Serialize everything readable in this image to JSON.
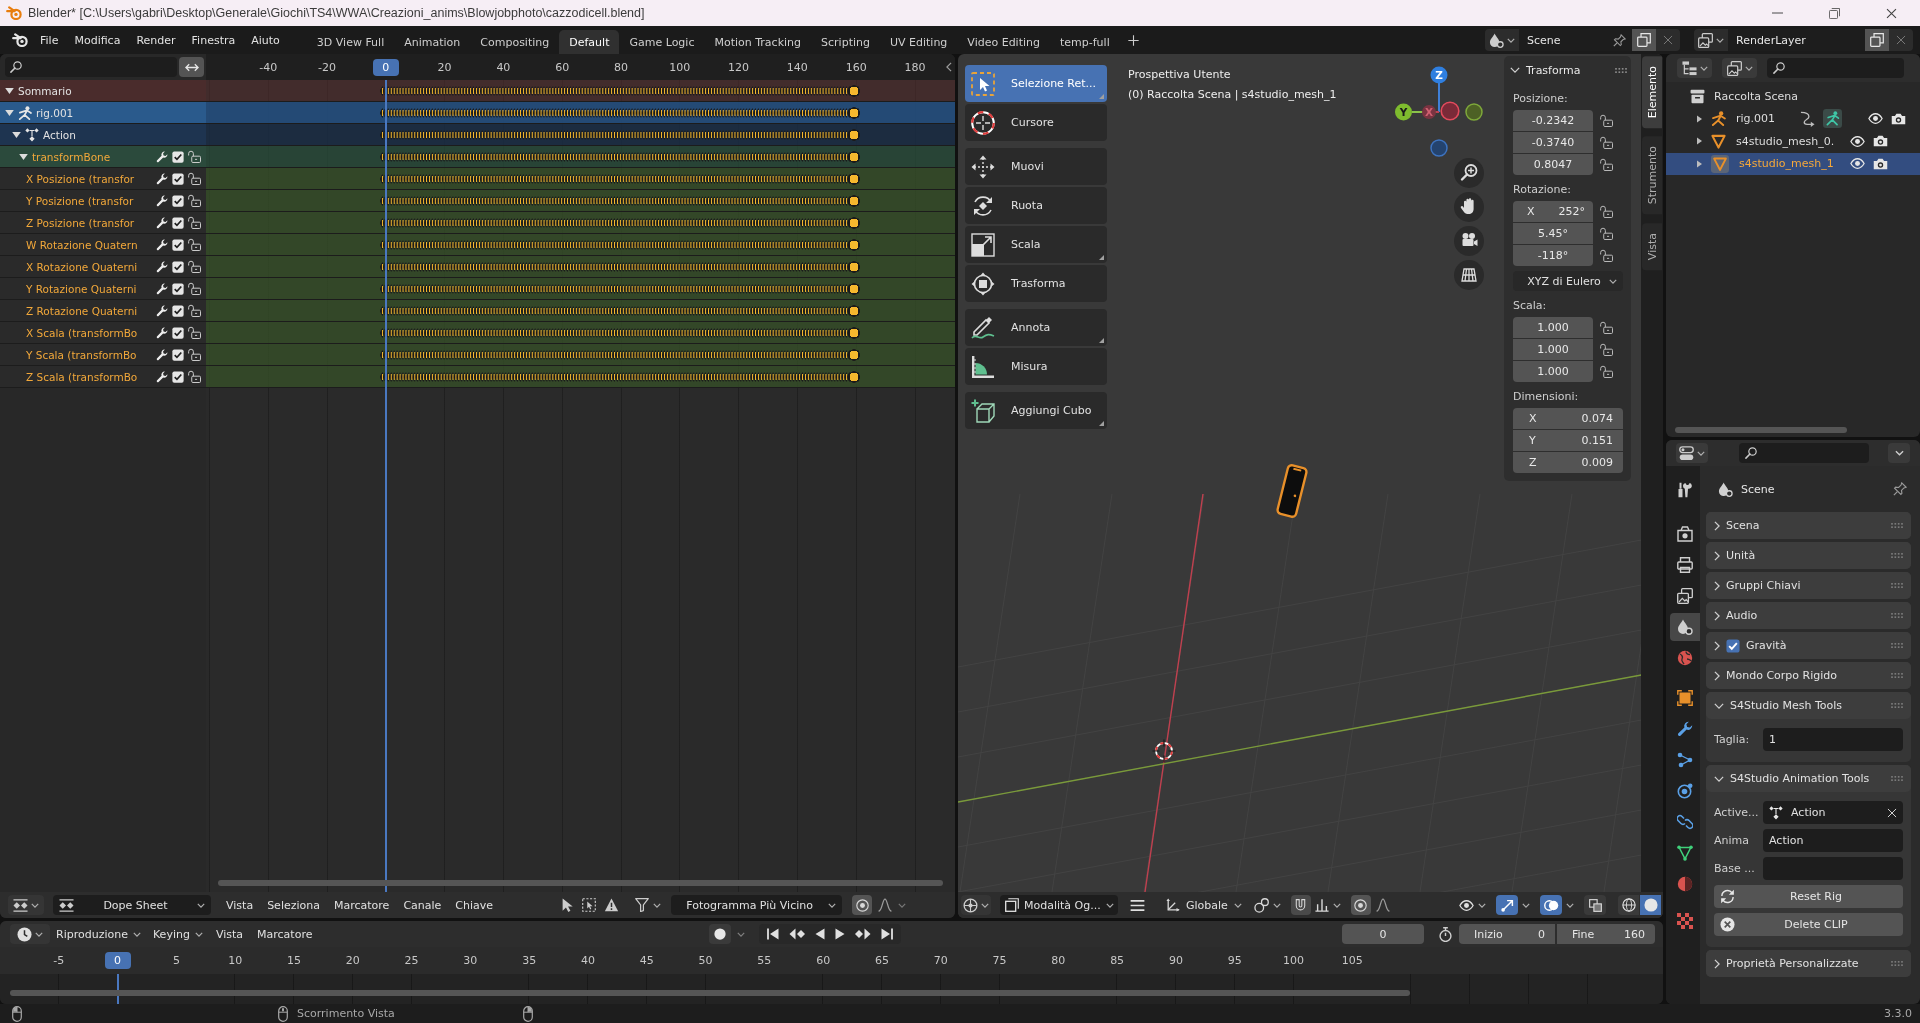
{
  "window": {
    "title": "Blender* [C:\\Users\\gabri\\Desktop\\Generale\\Giochi\\TS4\\WWA\\Creazioni_anims\\Blowjobphoto\\cazzodicell.blend]"
  },
  "menu": [
    "File",
    "Modifica",
    "Render",
    "Finestra",
    "Aiuto"
  ],
  "workspaces": [
    {
      "label": "3D View Full",
      "selected": false
    },
    {
      "label": "Animation",
      "selected": false
    },
    {
      "label": "Compositing",
      "selected": false
    },
    {
      "label": "Default",
      "selected": true
    },
    {
      "label": "Game Logic",
      "selected": false
    },
    {
      "label": "Motion Tracking",
      "selected": false
    },
    {
      "label": "Scripting",
      "selected": false
    },
    {
      "label": "UV Editing",
      "selected": false
    },
    {
      "label": "Video Editing",
      "selected": false
    },
    {
      "label": "temp-full",
      "selected": false
    }
  ],
  "scene": "Scene",
  "view_layer": "RenderLayer",
  "dope_sheet": {
    "ruler": [
      {
        "label": "-40",
        "current": false
      },
      {
        "label": "-20",
        "current": false
      },
      {
        "label": "0",
        "current": true
      },
      {
        "label": "20",
        "current": false
      },
      {
        "label": "40",
        "current": false
      },
      {
        "label": "60",
        "current": false
      },
      {
        "label": "80",
        "current": false
      },
      {
        "label": "100",
        "current": false
      },
      {
        "label": "120",
        "current": false
      },
      {
        "label": "140",
        "current": false
      },
      {
        "label": "160",
        "current": false
      },
      {
        "label": "180",
        "current": false
      }
    ],
    "channels": [
      {
        "kind": "summary",
        "label": "Sommario",
        "expanded": true,
        "selected": false
      },
      {
        "kind": "object",
        "label": "rig.001",
        "expanded": true,
        "selected": false,
        "children": [
          {
            "kind": "action",
            "label": "Action",
            "expanded": true,
            "selected": false,
            "children": [
              {
                "kind": "group",
                "label": "transformBone",
                "expanded": true,
                "selected": true,
                "checked": true,
                "locked": false,
                "children": [
                  {
                    "kind": "fcurve",
                    "label": "X Posizione (transfor",
                    "selected": true,
                    "checked": true,
                    "locked": false
                  },
                  {
                    "kind": "fcurve",
                    "label": "Y Posizione (transfor",
                    "selected": true,
                    "checked": true,
                    "locked": false
                  },
                  {
                    "kind": "fcurve",
                    "label": "Z Posizione (transfor",
                    "selected": true,
                    "checked": true,
                    "locked": false
                  },
                  {
                    "kind": "fcurve",
                    "label": "W Rotazione Quatern",
                    "selected": true,
                    "checked": true,
                    "locked": false
                  },
                  {
                    "kind": "fcurve",
                    "label": "X Rotazione Quaterni",
                    "selected": true,
                    "checked": true,
                    "locked": false
                  },
                  {
                    "kind": "fcurve",
                    "label": "Y Rotazione Quaterni",
                    "selected": true,
                    "checked": true,
                    "locked": false
                  },
                  {
                    "kind": "fcurve",
                    "label": "Z Rotazione Quaterni",
                    "selected": true,
                    "checked": true,
                    "locked": false
                  },
                  {
                    "kind": "fcurve",
                    "label": "X Scala (transformBo",
                    "selected": true,
                    "checked": true,
                    "locked": false
                  },
                  {
                    "kind": "fcurve",
                    "label": "Y Scala (transformBo",
                    "selected": true,
                    "checked": true,
                    "locked": false
                  },
                  {
                    "kind": "fcurve",
                    "label": "Z Scala (transformBo",
                    "selected": true,
                    "checked": true,
                    "locked": false
                  }
                ]
              }
            ]
          }
        ]
      }
    ],
    "header": {
      "mode": "Dope Sheet",
      "menus": [
        "Vista",
        "Seleziona",
        "Marcatore",
        "Canale",
        "Chiave"
      ],
      "snapping": "Fotogramma Più Vicino"
    }
  },
  "viewport": {
    "view_name": "Prospettiva Utente",
    "view_info": "(0) Raccolta Scena | s4studio_mesh_1",
    "toolbar": [
      {
        "tools": [
          {
            "label": "Selezione Ret...",
            "selected": true,
            "flyout": true
          },
          {
            "label": "Cursore",
            "selected": false,
            "flyout": false
          }
        ]
      },
      {
        "tools": [
          {
            "label": "Muovi",
            "selected": false,
            "flyout": false
          },
          {
            "label": "Ruota",
            "selected": false,
            "flyout": false
          },
          {
            "label": "Scala",
            "selected": false,
            "flyout": true
          },
          {
            "label": "Trasforma",
            "selected": false,
            "flyout": false
          }
        ]
      },
      {
        "tools": [
          {
            "label": "Annota",
            "selected": false,
            "flyout": true
          },
          {
            "label": "Misura",
            "selected": false,
            "flyout": false
          }
        ]
      },
      {
        "tools": [
          {
            "label": "Aggiungi Cubo",
            "selected": false,
            "flyout": true
          }
        ]
      }
    ],
    "gizmo_axes": [
      "Z",
      "Y",
      "X"
    ],
    "sidebar": {
      "tabs": [
        {
          "label": "Elemento",
          "selected": true
        },
        {
          "label": "Strumento",
          "selected": false
        },
        {
          "label": "Vista",
          "selected": false
        }
      ],
      "panel": {
        "title": "Trasforma",
        "expanded": true,
        "sections": [
          {
            "label": "Posizione:",
            "fields": [
              {
                "value": "-0.2342",
                "locked": false
              },
              {
                "value": "-0.3740",
                "locked": false
              },
              {
                "value": "0.8047",
                "locked": false
              }
            ]
          },
          {
            "label": "Rotazione:",
            "fields": [
              {
                "label": "X",
                "value": "252°",
                "locked": false
              },
              {
                "value": "5.45°",
                "locked": false
              },
              {
                "value": "-118°",
                "locked": false
              }
            ],
            "mode": "XYZ di Eulero"
          },
          {
            "label": "Scala:",
            "fields": [
              {
                "value": "1.000",
                "locked": false
              },
              {
                "value": "1.000",
                "locked": false
              },
              {
                "value": "1.000",
                "locked": false
              }
            ]
          },
          {
            "label": "Dimensioni:",
            "fields": [
              {
                "label": "X",
                "value": "0.074"
              },
              {
                "label": "Y",
                "value": "0.151"
              },
              {
                "label": "Z",
                "value": "0.009"
              }
            ]
          }
        ]
      }
    },
    "header": {
      "mode": "Modalità Og...",
      "orientation": "Globale",
      "gizmos_on": true,
      "overlays_on": true,
      "shading": [
        {
          "selected": false
        },
        {
          "selected": true
        }
      ]
    }
  },
  "timeline": {
    "menus": [
      {
        "kind": "dropdown",
        "label": "Riproduzione"
      },
      {
        "kind": "dropdown",
        "label": "Keying"
      },
      {
        "kind": "menu",
        "label": "Vista"
      },
      {
        "kind": "menu",
        "label": "Marcatore"
      }
    ],
    "current_frame": "0",
    "start": {
      "label": "Inizio",
      "value": "0"
    },
    "end": {
      "label": "Fine",
      "value": "160"
    },
    "ruler": [
      {
        "label": "-5",
        "current": false
      },
      {
        "label": "0",
        "current": true
      },
      {
        "label": "5",
        "current": false
      },
      {
        "label": "10",
        "current": false
      },
      {
        "label": "15",
        "current": false
      },
      {
        "label": "20",
        "current": false
      },
      {
        "label": "25",
        "current": false
      },
      {
        "label": "30",
        "current": false
      },
      {
        "label": "35",
        "current": false
      },
      {
        "label": "40",
        "current": false
      },
      {
        "label": "45",
        "current": false
      },
      {
        "label": "50",
        "current": false
      },
      {
        "label": "55",
        "current": false
      },
      {
        "label": "60",
        "current": false
      },
      {
        "label": "65",
        "current": false
      },
      {
        "label": "70",
        "current": false
      },
      {
        "label": "75",
        "current": false
      },
      {
        "label": "80",
        "current": false
      },
      {
        "label": "85",
        "current": false
      },
      {
        "label": "90",
        "current": false
      },
      {
        "label": "95",
        "current": false
      },
      {
        "label": "100",
        "current": false
      },
      {
        "label": "105",
        "current": false
      }
    ]
  },
  "outliner": {
    "items": [
      {
        "kind": "collection",
        "label": "Raccolta Scena",
        "selected": false,
        "children": [
          {
            "kind": "armature",
            "label": "rig.001",
            "selected": false,
            "expanded": false
          },
          {
            "kind": "mesh",
            "label": "s4studio_mesh_0.",
            "selected": false,
            "expanded": false
          },
          {
            "kind": "mesh",
            "label": "s4studio_mesh_1",
            "selected": true,
            "expanded": false
          }
        ]
      }
    ]
  },
  "properties": {
    "tabs": [
      {
        "selected": false
      },
      {
        "selected": false
      },
      {
        "selected": false
      },
      {
        "selected": false
      },
      {
        "selected": true
      },
      {
        "selected": false
      },
      {
        "selected": false
      },
      {
        "selected": false
      },
      {
        "selected": false
      },
      {
        "selected": false
      },
      {
        "selected": false
      },
      {
        "selected": false
      },
      {
        "selected": false
      },
      {
        "selected": false
      }
    ],
    "context": "Scene",
    "panels": [
      {
        "label": "Scena",
        "expanded": false
      },
      {
        "label": "Unità",
        "expanded": false
      },
      {
        "label": "Gruppi Chiavi",
        "expanded": false
      },
      {
        "label": "Audio",
        "expanded": false
      },
      {
        "label": "Gravità",
        "expanded": false,
        "checked": true
      },
      {
        "label": "Mondo Corpo Rigido",
        "expanded": false
      },
      {
        "label": "S4Studio Mesh Tools",
        "expanded": true,
        "rows": [
          {
            "kind": "field",
            "label": "Taglia:",
            "value": "1"
          }
        ]
      },
      {
        "label": "S4Studio Animation Tools",
        "expanded": true,
        "rows": [
          {
            "kind": "data_field",
            "label": "Active...",
            "value": "Action"
          },
          {
            "kind": "field",
            "label": "Anima",
            "value": "Action"
          },
          {
            "kind": "field",
            "label": "Base ..."
          },
          {
            "kind": "button",
            "label": "Reset Rig"
          },
          {
            "kind": "button",
            "label": "Delete CLIP"
          }
        ]
      },
      {
        "label": "Proprietà Personalizzate",
        "expanded": false
      }
    ]
  },
  "status_bar": {
    "hint": "Scorrimento Vista",
    "version": "3.3.0"
  }
}
